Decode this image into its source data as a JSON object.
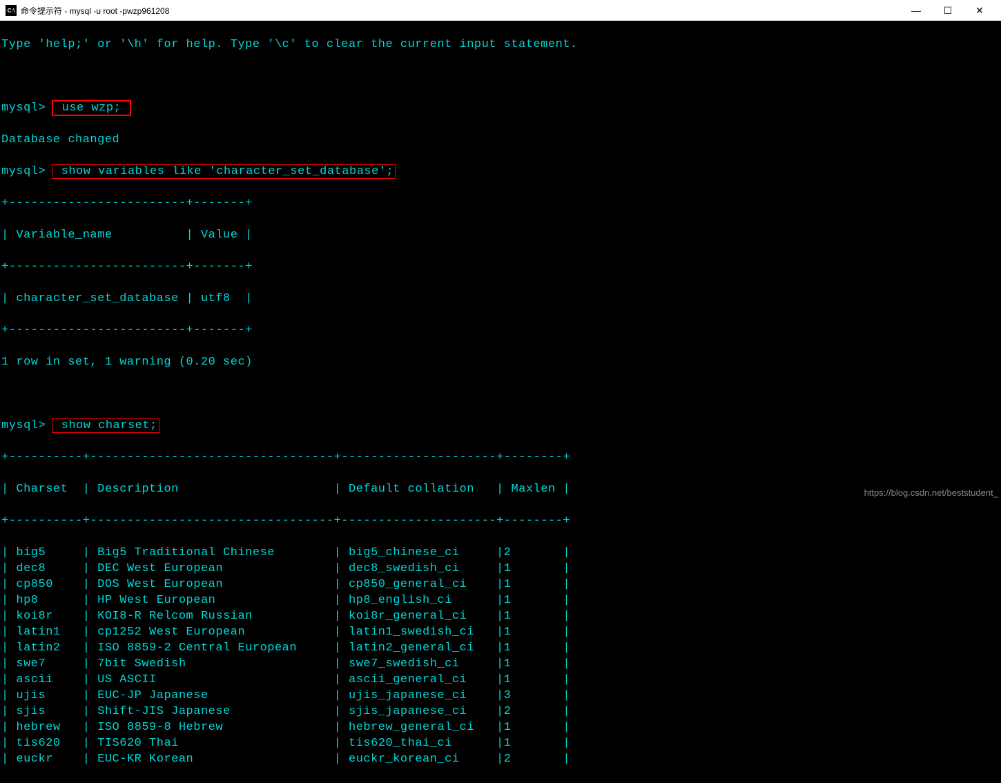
{
  "window": {
    "title": "命令提示符 - mysql  -u root -pwzp961208"
  },
  "lines": {
    "help": "Type 'help;' or '\\h' for help. Type '\\c' to clear the current input statement.",
    "prompt1": "mysql>",
    "cmd1": " use wzp; ",
    "dbchanged": "Database changed",
    "prompt2": "mysql>",
    "cmd2": " show variables like 'character_set_database';",
    "sep1": "+------------------------+-------+",
    "hdr1_col1": " Variable_name          ",
    "hdr1_col2": " Value ",
    "row1_col1": " character_set_database ",
    "row1_col2": " utf8  ",
    "rowinfo": "1 row in set, 1 warning (0.20 sec)",
    "prompt3": "mysql>",
    "cmd3": " show charset;",
    "sep2": "+----------+---------------------------------+---------------------+--------+",
    "hdr2_c1": " Charset  ",
    "hdr2_c2": " Description                     ",
    "hdr2_c3": " Default collation   ",
    "hdr2_c4": " Maxlen "
  },
  "charset_rows": [
    {
      "charset": "big5",
      "desc": "Big5 Traditional Chinese",
      "coll": "big5_chinese_ci",
      "maxlen": "2"
    },
    {
      "charset": "dec8",
      "desc": "DEC West European",
      "coll": "dec8_swedish_ci",
      "maxlen": "1"
    },
    {
      "charset": "cp850",
      "desc": "DOS West European",
      "coll": "cp850_general_ci",
      "maxlen": "1"
    },
    {
      "charset": "hp8",
      "desc": "HP West European",
      "coll": "hp8_english_ci",
      "maxlen": "1"
    },
    {
      "charset": "koi8r",
      "desc": "KOI8-R Relcom Russian",
      "coll": "koi8r_general_ci",
      "maxlen": "1"
    },
    {
      "charset": "latin1",
      "desc": "cp1252 West European",
      "coll": "latin1_swedish_ci",
      "maxlen": "1"
    },
    {
      "charset": "latin2",
      "desc": "ISO 8859-2 Central European",
      "coll": "latin2_general_ci",
      "maxlen": "1"
    },
    {
      "charset": "swe7",
      "desc": "7bit Swedish",
      "coll": "swe7_swedish_ci",
      "maxlen": "1"
    },
    {
      "charset": "ascii",
      "desc": "US ASCII",
      "coll": "ascii_general_ci",
      "maxlen": "1"
    },
    {
      "charset": "ujis",
      "desc": "EUC-JP Japanese",
      "coll": "ujis_japanese_ci",
      "maxlen": "3"
    },
    {
      "charset": "sjis",
      "desc": "Shift-JIS Japanese",
      "coll": "sjis_japanese_ci",
      "maxlen": "2"
    },
    {
      "charset": "hebrew",
      "desc": "ISO 8859-8 Hebrew",
      "coll": "hebrew_general_ci",
      "maxlen": "1"
    },
    {
      "charset": "tis620",
      "desc": "TIS620 Thai",
      "coll": "tis620_thai_ci",
      "maxlen": "1"
    },
    {
      "charset": "euckr",
      "desc": "EUC-KR Korean",
      "coll": "euckr_korean_ci",
      "maxlen": "2"
    }
  ],
  "watermark": "https://blog.csdn.net/beststudent_"
}
